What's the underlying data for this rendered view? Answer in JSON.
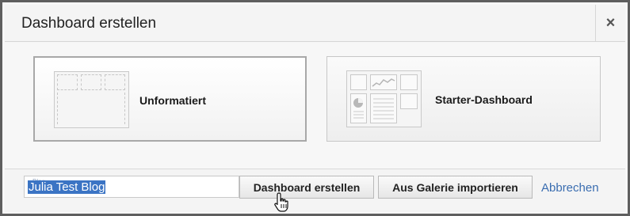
{
  "dialog": {
    "title": "Dashboard erstellen",
    "close_symbol": "×"
  },
  "options": [
    {
      "label": "Unformatiert",
      "selected": true
    },
    {
      "label": "Starter-Dashboard",
      "selected": false
    }
  ],
  "footer": {
    "name_value": "Julia Test Blog",
    "name_ghost": "Blog",
    "create_label": "Dashboard erstellen",
    "import_label": "Aus Galerie importieren",
    "cancel_label": "Abbrechen"
  },
  "colors": {
    "link": "#3a6db0",
    "selection": "#3b74c4",
    "frame": "#5f5f5f"
  },
  "icons": [
    "close-icon",
    "blank-layout-icon",
    "starter-layout-icon",
    "hand-pointer-icon"
  ]
}
